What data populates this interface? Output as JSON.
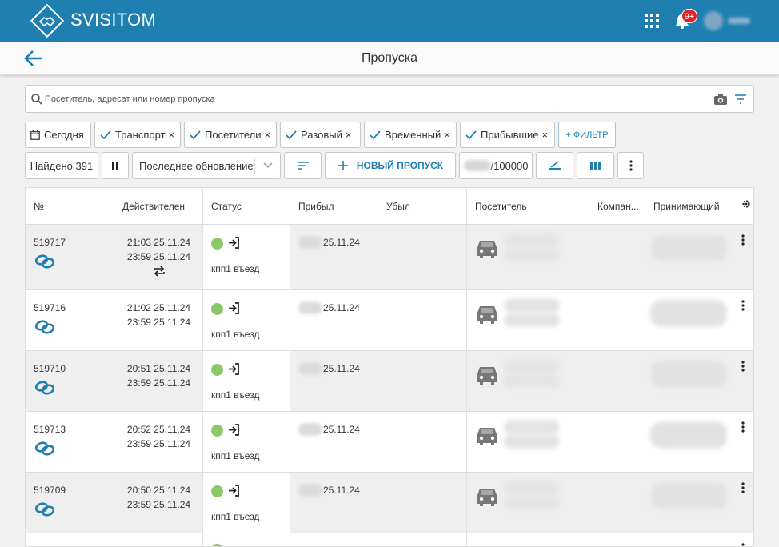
{
  "app": {
    "brand": "SVISITOM",
    "notifications_badge": "9+",
    "accent_color": "#1f7fb0"
  },
  "header": {
    "title": "Пропуска"
  },
  "search": {
    "placeholder": "Посетитель, адресат или номер пропуска"
  },
  "chips": [
    {
      "label": "Сегодня",
      "icon": "calendar-icon",
      "removable": false
    },
    {
      "label": "Транспорт",
      "icon": "check-icon",
      "removable": true
    },
    {
      "label": "Посетители",
      "icon": "check-icon",
      "removable": true
    },
    {
      "label": "Разовый",
      "icon": "check-icon",
      "removable": true
    },
    {
      "label": "Временный",
      "icon": "check-icon",
      "removable": true
    },
    {
      "label": "Прибывшие",
      "icon": "check-icon",
      "removable": true
    }
  ],
  "filter_button": "+ ФИЛЬТР",
  "close_glyph": "×",
  "toolbar": {
    "found": "Найдено 391",
    "refresh_mode": "Последнее обновление",
    "new_pass": "НОВЫЙ ПРОПУСК",
    "counter": "/100000"
  },
  "table": {
    "columns": [
      "№",
      "Действителен",
      "Статус",
      "Прибыл",
      "Убыл",
      "Посетитель",
      "Компан...",
      "Принимающий"
    ],
    "rows": [
      {
        "number": "519717",
        "valid_from": "21:03 25.11.24",
        "valid_to": "23:59 25.11.24",
        "status_text": "кпп1 въезд",
        "arrived": "25.11.24",
        "left": "",
        "recurring": true
      },
      {
        "number": "519716",
        "valid_from": "21:02 25.11.24",
        "valid_to": "23:59 25.11.24",
        "status_text": "кпп1 въезд",
        "arrived": "25.11.24",
        "left": "",
        "recurring": false
      },
      {
        "number": "519710",
        "valid_from": "20:51 25.11.24",
        "valid_to": "23:59 25.11.24",
        "status_text": "кпп1 въезд",
        "arrived": "25.11.24",
        "left": "",
        "recurring": false
      },
      {
        "number": "519713",
        "valid_from": "20:52 25.11.24",
        "valid_to": "23:59 25.11.24",
        "status_text": "кпп1 въезд",
        "arrived": "25.11.24",
        "left": "",
        "recurring": false
      },
      {
        "number": "519709",
        "valid_from": "20:50 25.11.24",
        "valid_to": "23:59 25.11.24",
        "status_text": "кпп1 въезд",
        "arrived": "25.11.24",
        "left": "",
        "recurring": false
      }
    ],
    "status_color": "#8bc869"
  }
}
